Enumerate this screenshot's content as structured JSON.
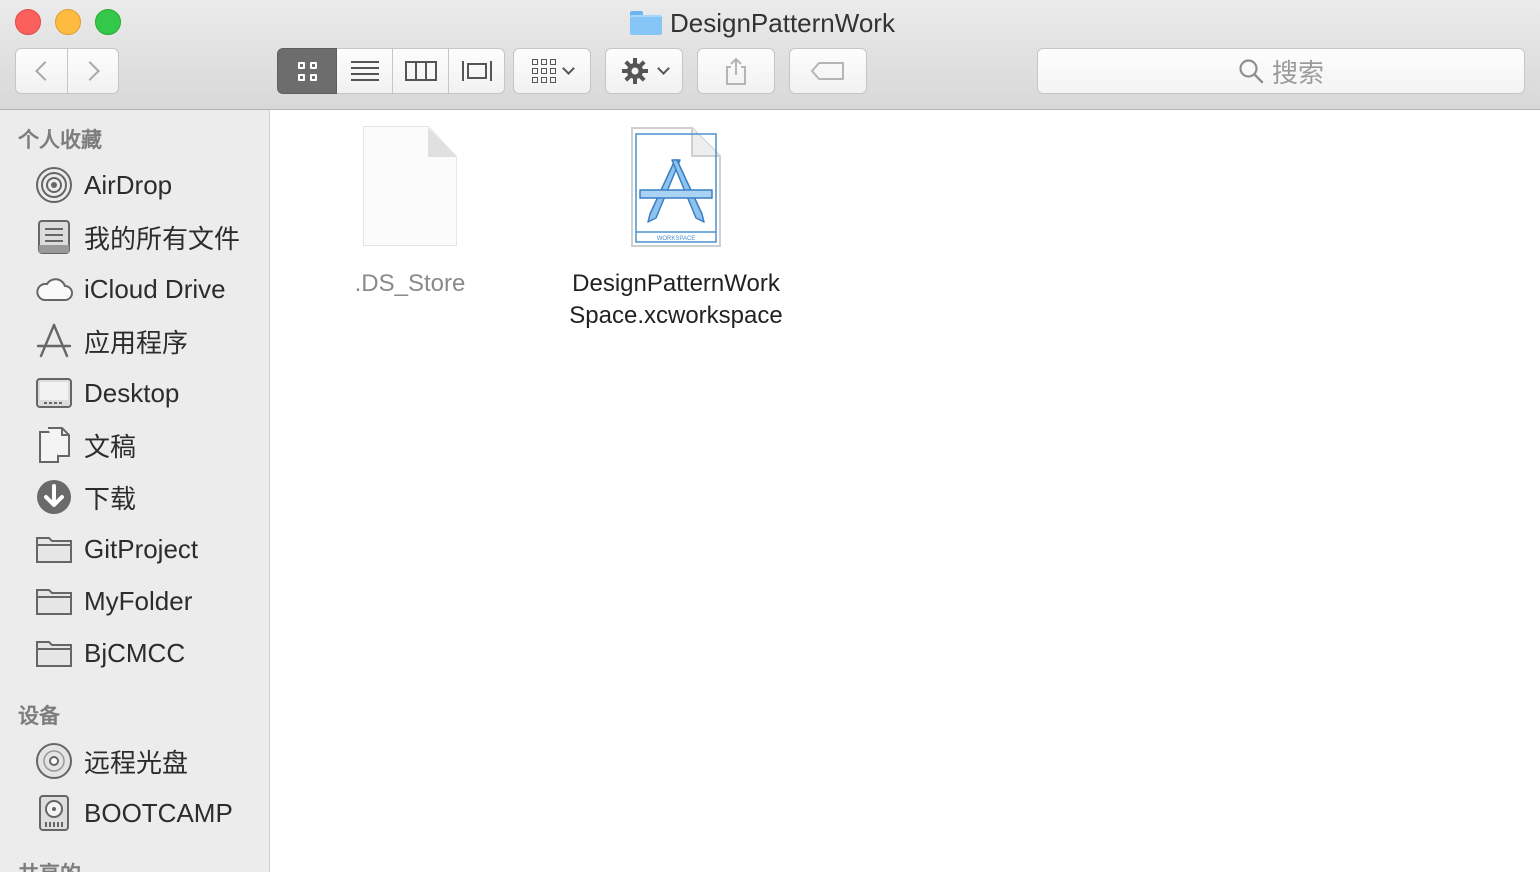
{
  "window": {
    "title": "DesignPatternWork"
  },
  "toolbar": {
    "search_placeholder": "搜索",
    "view_modes": [
      "icon-view",
      "list-view",
      "column-view",
      "cover-flow-view"
    ],
    "active_view": "icon-view"
  },
  "sidebar": {
    "favorites_title": "个人收藏",
    "favorites": [
      {
        "label": "AirDrop",
        "icon": "airdrop-icon"
      },
      {
        "label": "我的所有文件",
        "icon": "all-my-files-icon"
      },
      {
        "label": "iCloud Drive",
        "icon": "cloud-icon"
      },
      {
        "label": "应用程序",
        "icon": "applications-icon"
      },
      {
        "label": "Desktop",
        "icon": "desktop-icon"
      },
      {
        "label": "文稿",
        "icon": "documents-icon"
      },
      {
        "label": "下载",
        "icon": "downloads-icon"
      },
      {
        "label": "GitProject",
        "icon": "folder-icon"
      },
      {
        "label": "MyFolder",
        "icon": "folder-icon"
      },
      {
        "label": "BjCMCC",
        "icon": "folder-icon"
      }
    ],
    "devices_title": "设备",
    "devices": [
      {
        "label": "远程光盘",
        "icon": "optical-disc-icon"
      },
      {
        "label": "BOOTCAMP",
        "icon": "hard-drive-icon"
      }
    ],
    "shared_title": "共享的"
  },
  "files": [
    {
      "name": ".DS_Store",
      "hidden": true,
      "icon": "blank-document-icon"
    },
    {
      "name_line1": "DesignPatternWork",
      "name_line2": "Space.xcworkspace",
      "hidden": false,
      "icon": "xcode-workspace-icon",
      "badge": "WORKSPACE"
    }
  ],
  "colors": {
    "folder_blue": "#86c6f6",
    "active_view_bg": "#6d6d6d",
    "sidebar_bg": "#ececec"
  }
}
